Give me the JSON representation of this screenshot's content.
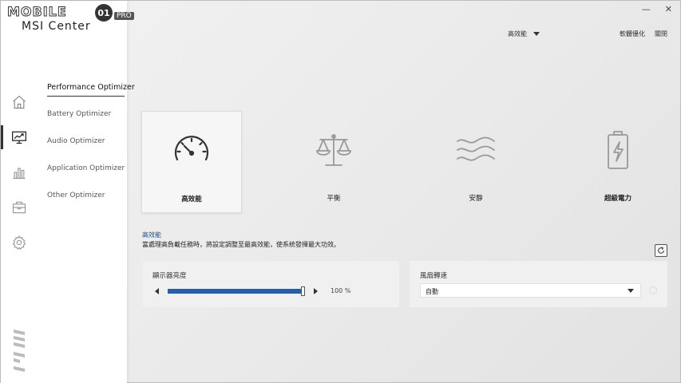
{
  "brand": {
    "watermark": "MOBILE",
    "badge": "01",
    "pro": "PRO",
    "title": "MSI Center"
  },
  "window": {
    "minimize": "—",
    "close": "✕"
  },
  "header": {
    "mode_value": "高效能",
    "links": [
      "軟體優化",
      "關閉"
    ]
  },
  "sidebar": {
    "icons": [
      "home-icon",
      "monitor-chart-icon",
      "bar-chart-icon",
      "toolbox-icon",
      "gear-icon"
    ],
    "menu": [
      "Performance Optimizer",
      "Battery Optimizer",
      "Audio Optimizer",
      "Application Optimizer",
      "Other Optimizer"
    ]
  },
  "modes": [
    {
      "label": "高效能",
      "icon": "speedometer-icon"
    },
    {
      "label": "平衡",
      "icon": "scale-icon"
    },
    {
      "label": "安靜",
      "icon": "wind-icon"
    },
    {
      "label": "超級電力",
      "icon": "battery-bolt-icon"
    }
  ],
  "description": {
    "title": "高效能",
    "text": "當處理高負載任務時，將設定調整至最高效能，使系統發揮最大功效。"
  },
  "brightness": {
    "title": "顯示器亮度",
    "value": "100 %",
    "level": 1.0
  },
  "fan": {
    "title": "風扇轉速",
    "value": "自動"
  },
  "colors": {
    "accent": "#2a5da8",
    "desc_title": "#1f4f8f"
  }
}
